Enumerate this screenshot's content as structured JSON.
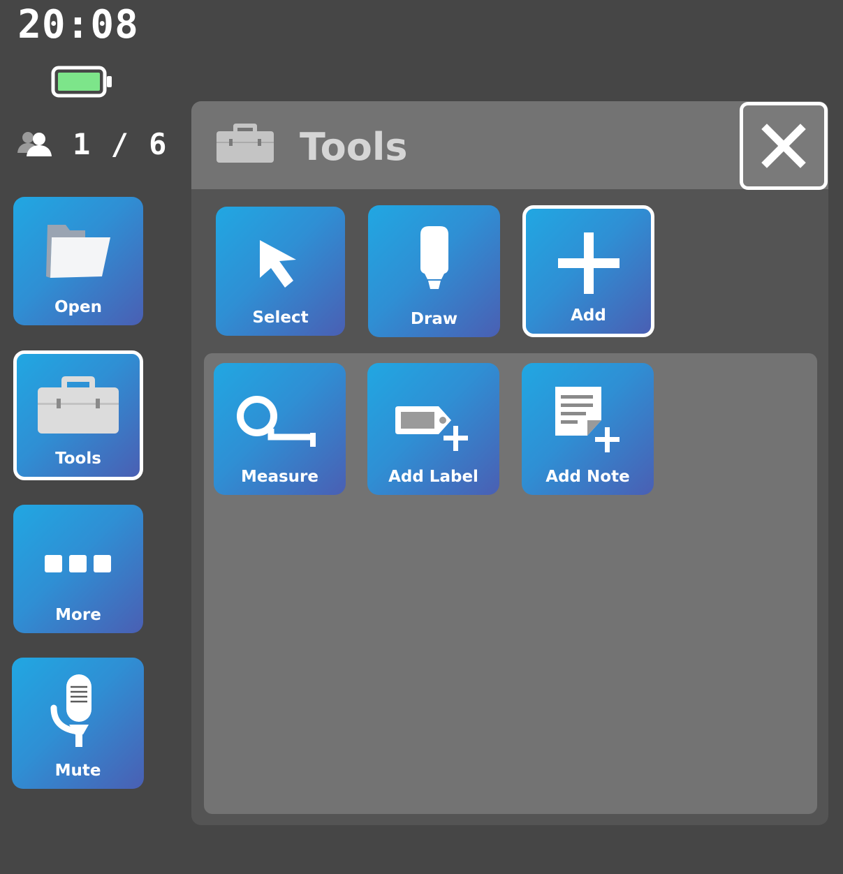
{
  "status": {
    "time": "20:08",
    "battery_color": "#7de58a",
    "participants": "1 / 6"
  },
  "sidebar": {
    "open_label": "Open",
    "tools_label": "Tools",
    "more_label": "More",
    "mute_label": "Mute"
  },
  "panel": {
    "title": "Tools",
    "tools": {
      "select_label": "Select",
      "draw_label": "Draw",
      "add_label": "Add"
    },
    "add_options": {
      "measure_label": "Measure",
      "add_label_label": "Add Label",
      "add_note_label": "Add Note"
    }
  },
  "icons": {
    "open": "folder-icon",
    "tools": "toolbox-icon",
    "more": "ellipsis-icon",
    "mute": "microphone-icon",
    "select": "cursor-arrow-icon",
    "draw": "marker-icon",
    "add": "plus-icon",
    "measure": "tape-measure-icon",
    "add_label": "tag-plus-icon",
    "add_note": "note-plus-icon",
    "close": "close-icon"
  },
  "colors": {
    "background": "#464646",
    "panel": "#545454",
    "panel_header": "#737373",
    "tile_gradient_start": "#21a7e2",
    "tile_gradient_end": "#4a5fb3"
  }
}
